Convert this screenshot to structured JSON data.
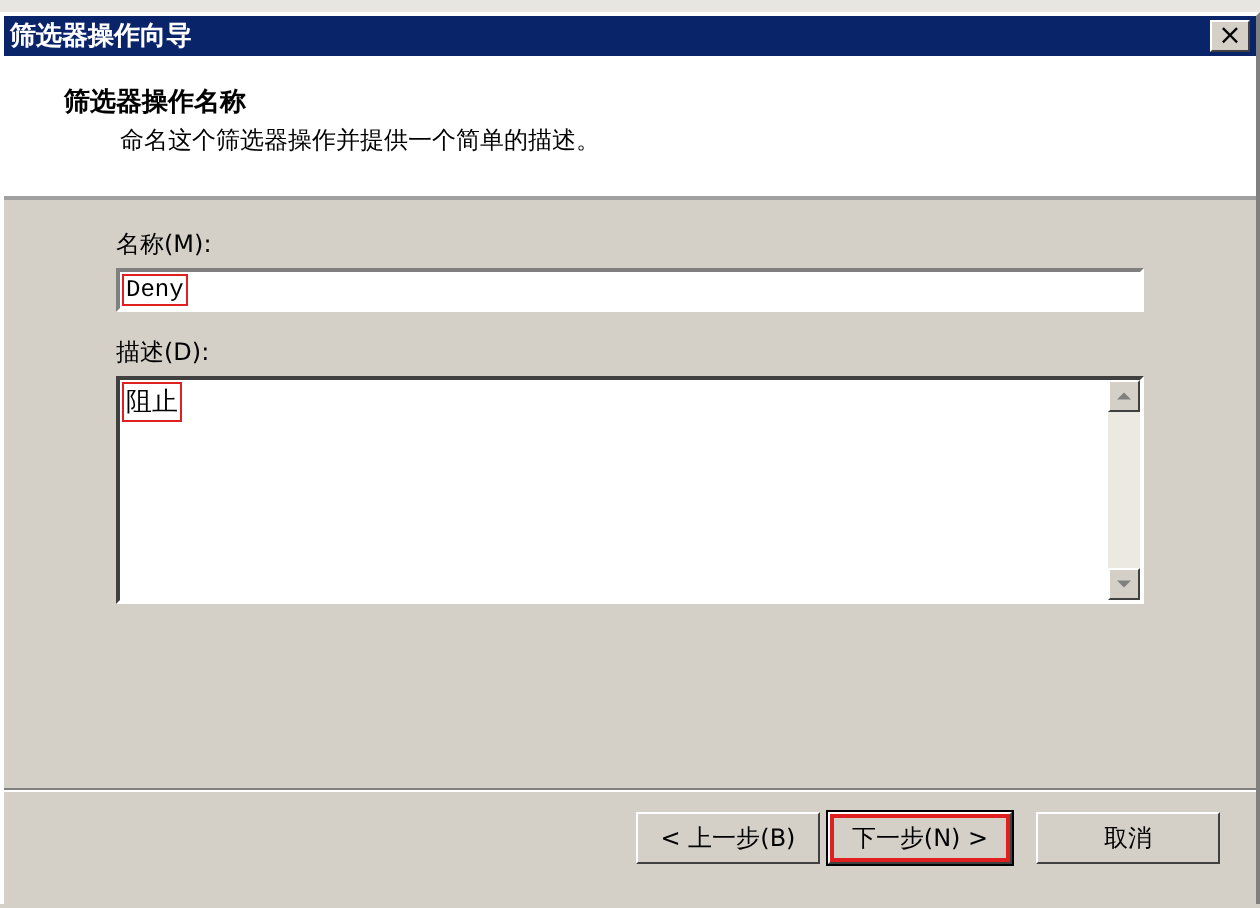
{
  "window": {
    "title": "筛选器操作向导",
    "close": "×"
  },
  "header": {
    "title": "筛选器操作名称",
    "subtitle": "命名这个筛选器操作并提供一个简单的描述。"
  },
  "name_field": {
    "label": "名称(M):",
    "value": "Deny",
    "highlighted": true
  },
  "description_field": {
    "label": "描述(D):",
    "value": "阻止",
    "highlighted": true
  },
  "buttons": [
    {
      "label": "< 上一步(B)",
      "default": false,
      "highlighted": false
    },
    {
      "label": "下一步(N) >",
      "default": true,
      "highlighted": true
    },
    {
      "label": "取消",
      "default": false,
      "highlighted": false
    }
  ]
}
